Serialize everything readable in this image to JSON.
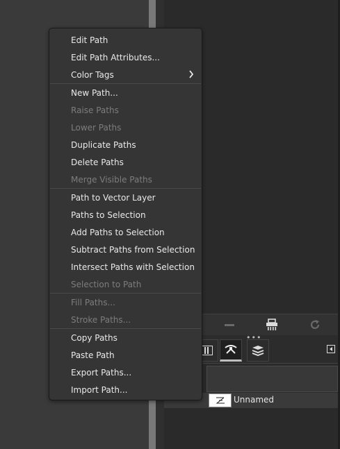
{
  "context_menu": {
    "items": [
      {
        "label": "Edit Path",
        "enabled": true
      },
      {
        "label": "Edit Path Attributes...",
        "enabled": true
      },
      {
        "label": "Color Tags",
        "enabled": true,
        "submenu": true
      },
      {
        "label": "New Path...",
        "enabled": true
      },
      {
        "label": "Raise Paths",
        "enabled": false
      },
      {
        "label": "Lower Paths",
        "enabled": false
      },
      {
        "label": "Duplicate Paths",
        "enabled": true
      },
      {
        "label": "Delete Paths",
        "enabled": true
      },
      {
        "label": "Merge Visible Paths",
        "enabled": false
      },
      {
        "label": "Path to Vector Layer",
        "enabled": true
      },
      {
        "label": "Paths to Selection",
        "enabled": true
      },
      {
        "label": "Add Paths to Selection",
        "enabled": true
      },
      {
        "label": "Subtract Paths from Selection",
        "enabled": true
      },
      {
        "label": "Intersect Paths with Selection",
        "enabled": true
      },
      {
        "label": "Selection to Path",
        "enabled": false
      },
      {
        "label": "Fill Paths...",
        "enabled": false
      },
      {
        "label": "Stroke Paths...",
        "enabled": false
      },
      {
        "label": "Copy Paths",
        "enabled": true
      },
      {
        "label": "Paste Path",
        "enabled": true
      },
      {
        "label": "Export Paths...",
        "enabled": true
      },
      {
        "label": "Import Path...",
        "enabled": true
      }
    ]
  },
  "paths_panel": {
    "toolbar_icons": [
      "minus-icon",
      "shredder-icon",
      "refresh-icon"
    ],
    "tabs": [
      "channels-icon",
      "paths-icon",
      "layers-icon"
    ],
    "active_tab": "paths-icon",
    "items": [
      {
        "name": "Unnamed"
      }
    ]
  },
  "colors": {
    "menu_bg": "#353535",
    "menu_text": "#eaeaea",
    "menu_text_disabled": "#7d7d7d"
  }
}
